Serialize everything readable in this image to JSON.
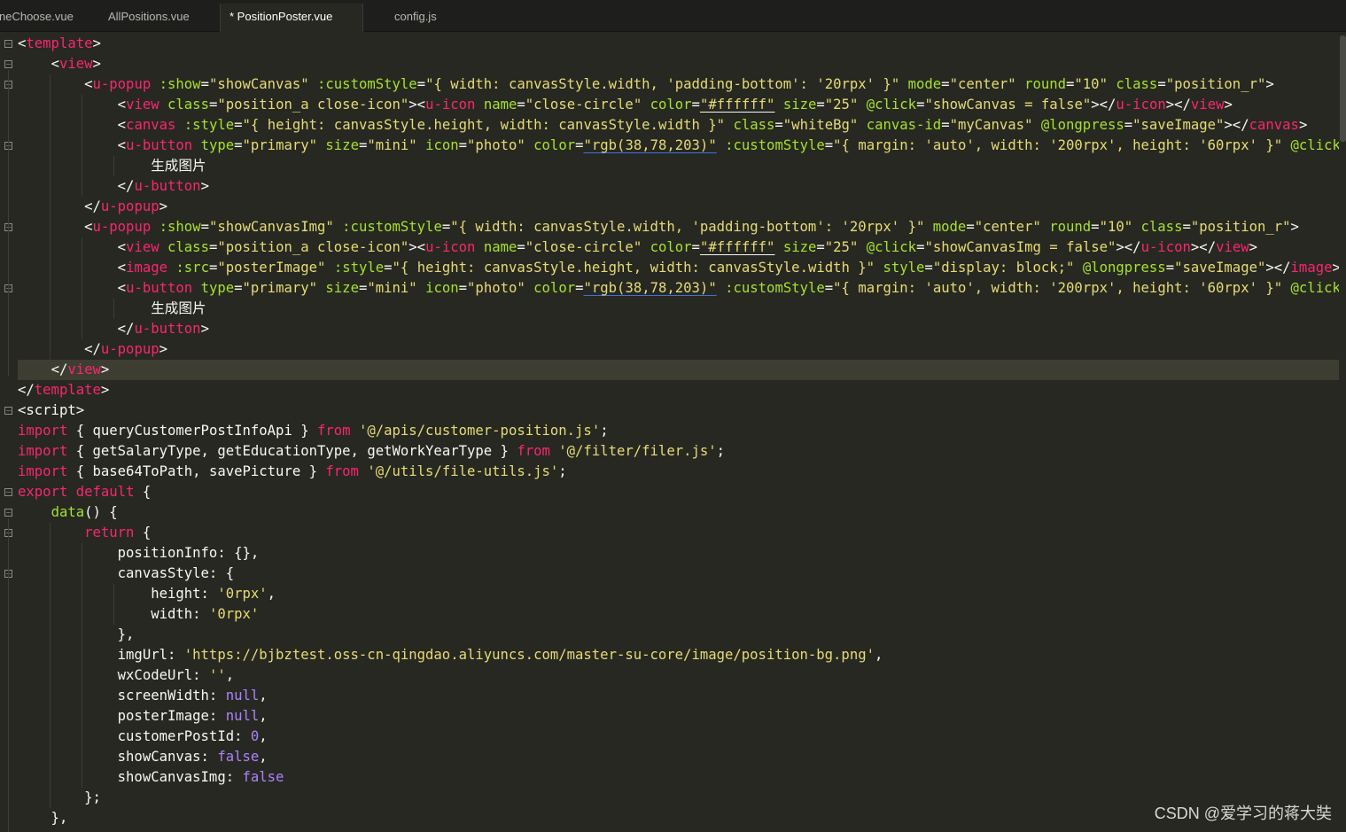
{
  "tabs": [
    {
      "label": "neChoose.vue",
      "active": false
    },
    {
      "label": "AllPositions.vue",
      "active": false
    },
    {
      "label": "* PositionPoster.vue",
      "active": true
    },
    {
      "label": "config.js",
      "active": false
    }
  ],
  "highlighted_line": 17,
  "folded_lines": [
    1,
    2,
    3,
    6,
    10,
    13,
    19,
    23,
    24,
    25,
    27
  ],
  "code_lines": [
    [
      [
        "t-punc",
        "<"
      ],
      [
        "t-tag",
        "template"
      ],
      [
        "t-punc",
        ">"
      ]
    ],
    [
      [
        "t-txt",
        "    "
      ],
      [
        "t-punc",
        "<"
      ],
      [
        "t-tag",
        "view"
      ],
      [
        "t-punc",
        ">"
      ]
    ],
    [
      [
        "t-txt",
        "        "
      ],
      [
        "t-punc",
        "<"
      ],
      [
        "t-tag",
        "u-popup"
      ],
      [
        "t-txt",
        " "
      ],
      [
        "t-attr",
        ":show"
      ],
      [
        "t-punc",
        "="
      ],
      [
        "t-str",
        "\"showCanvas\""
      ],
      [
        "t-txt",
        " "
      ],
      [
        "t-attr",
        ":customStyle"
      ],
      [
        "t-punc",
        "="
      ],
      [
        "t-str",
        "\"{ width: canvasStyle.width, 'padding-bottom': '20rpx' }\""
      ],
      [
        "t-txt",
        " "
      ],
      [
        "t-attr",
        "mode"
      ],
      [
        "t-punc",
        "="
      ],
      [
        "t-str",
        "\"center\""
      ],
      [
        "t-txt",
        " "
      ],
      [
        "t-attr",
        "round"
      ],
      [
        "t-punc",
        "="
      ],
      [
        "t-str",
        "\"10\""
      ],
      [
        "t-txt",
        " "
      ],
      [
        "t-attr",
        "class"
      ],
      [
        "t-punc",
        "="
      ],
      [
        "t-str",
        "\"position_r\""
      ],
      [
        "t-punc",
        ">"
      ]
    ],
    [
      [
        "t-txt",
        "            "
      ],
      [
        "t-punc",
        "<"
      ],
      [
        "t-tag",
        "view"
      ],
      [
        "t-txt",
        " "
      ],
      [
        "t-attr",
        "class"
      ],
      [
        "t-punc",
        "="
      ],
      [
        "t-str",
        "\"position_a close-icon\""
      ],
      [
        "t-punc",
        "><"
      ],
      [
        "t-tag",
        "u-icon"
      ],
      [
        "t-txt",
        " "
      ],
      [
        "t-attr",
        "name"
      ],
      [
        "t-punc",
        "="
      ],
      [
        "t-str",
        "\"close-circle\""
      ],
      [
        "t-txt",
        " "
      ],
      [
        "t-attr",
        "color"
      ],
      [
        "t-punc",
        "="
      ],
      [
        "t-str t-ulw",
        "\"#ffffff\""
      ],
      [
        "t-txt",
        " "
      ],
      [
        "t-attr",
        "size"
      ],
      [
        "t-punc",
        "="
      ],
      [
        "t-str",
        "\"25\""
      ],
      [
        "t-txt",
        " "
      ],
      [
        "t-attr",
        "@click"
      ],
      [
        "t-punc",
        "="
      ],
      [
        "t-str",
        "\"showCanvas = false\""
      ],
      [
        "t-punc",
        "></"
      ],
      [
        "t-tag",
        "u-icon"
      ],
      [
        "t-punc",
        "></"
      ],
      [
        "t-tag",
        "view"
      ],
      [
        "t-punc",
        ">"
      ]
    ],
    [
      [
        "t-txt",
        "            "
      ],
      [
        "t-punc",
        "<"
      ],
      [
        "t-tag",
        "canvas"
      ],
      [
        "t-txt",
        " "
      ],
      [
        "t-attr",
        ":style"
      ],
      [
        "t-punc",
        "="
      ],
      [
        "t-str",
        "\"{ height: canvasStyle.height, width: canvasStyle.width }\""
      ],
      [
        "t-txt",
        " "
      ],
      [
        "t-attr",
        "class"
      ],
      [
        "t-punc",
        "="
      ],
      [
        "t-str",
        "\"whiteBg\""
      ],
      [
        "t-txt",
        " "
      ],
      [
        "t-attr",
        "canvas-id"
      ],
      [
        "t-punc",
        "="
      ],
      [
        "t-str",
        "\"myCanvas\""
      ],
      [
        "t-txt",
        " "
      ],
      [
        "t-attr",
        "@longpress"
      ],
      [
        "t-punc",
        "="
      ],
      [
        "t-str",
        "\"saveImage\""
      ],
      [
        "t-punc",
        "></"
      ],
      [
        "t-tag",
        "canvas"
      ],
      [
        "t-punc",
        ">"
      ]
    ],
    [
      [
        "t-txt",
        "            "
      ],
      [
        "t-punc",
        "<"
      ],
      [
        "t-tag",
        "u-button"
      ],
      [
        "t-txt",
        " "
      ],
      [
        "t-attr",
        "type"
      ],
      [
        "t-punc",
        "="
      ],
      [
        "t-str",
        "\"primary\""
      ],
      [
        "t-txt",
        " "
      ],
      [
        "t-attr",
        "size"
      ],
      [
        "t-punc",
        "="
      ],
      [
        "t-str",
        "\"mini\""
      ],
      [
        "t-txt",
        " "
      ],
      [
        "t-attr",
        "icon"
      ],
      [
        "t-punc",
        "="
      ],
      [
        "t-str",
        "\"photo\""
      ],
      [
        "t-txt",
        " "
      ],
      [
        "t-attr",
        "color"
      ],
      [
        "t-punc",
        "="
      ],
      [
        "t-str t-ul",
        "\"rgb(38,78,203)\""
      ],
      [
        "t-txt",
        " "
      ],
      [
        "t-attr",
        ":customStyle"
      ],
      [
        "t-punc",
        "="
      ],
      [
        "t-str",
        "\"{ margin: 'auto', width: '200rpx', height: '60rpx' }\""
      ],
      [
        "t-txt",
        " "
      ],
      [
        "t-attr",
        "@click"
      ],
      [
        "t-punc",
        "="
      ],
      [
        "t-str",
        "\"saveI"
      ]
    ],
    [
      [
        "t-txt",
        "                生成图片"
      ]
    ],
    [
      [
        "t-txt",
        "            "
      ],
      [
        "t-punc",
        "</"
      ],
      [
        "t-tag",
        "u-button"
      ],
      [
        "t-punc",
        ">"
      ]
    ],
    [
      [
        "t-txt",
        "        "
      ],
      [
        "t-punc",
        "</"
      ],
      [
        "t-tag",
        "u-popup"
      ],
      [
        "t-punc",
        ">"
      ]
    ],
    [
      [
        "t-txt",
        "        "
      ],
      [
        "t-punc",
        "<"
      ],
      [
        "t-tag",
        "u-popup"
      ],
      [
        "t-txt",
        " "
      ],
      [
        "t-attr",
        ":show"
      ],
      [
        "t-punc",
        "="
      ],
      [
        "t-str",
        "\"showCanvasImg\""
      ],
      [
        "t-txt",
        " "
      ],
      [
        "t-attr",
        ":customStyle"
      ],
      [
        "t-punc",
        "="
      ],
      [
        "t-str",
        "\"{ width: canvasStyle.width, 'padding-bottom': '20rpx' }\""
      ],
      [
        "t-txt",
        " "
      ],
      [
        "t-attr",
        "mode"
      ],
      [
        "t-punc",
        "="
      ],
      [
        "t-str",
        "\"center\""
      ],
      [
        "t-txt",
        " "
      ],
      [
        "t-attr",
        "round"
      ],
      [
        "t-punc",
        "="
      ],
      [
        "t-str",
        "\"10\""
      ],
      [
        "t-txt",
        " "
      ],
      [
        "t-attr",
        "class"
      ],
      [
        "t-punc",
        "="
      ],
      [
        "t-str",
        "\"position_r\""
      ],
      [
        "t-punc",
        ">"
      ]
    ],
    [
      [
        "t-txt",
        "            "
      ],
      [
        "t-punc",
        "<"
      ],
      [
        "t-tag",
        "view"
      ],
      [
        "t-txt",
        " "
      ],
      [
        "t-attr",
        "class"
      ],
      [
        "t-punc",
        "="
      ],
      [
        "t-str",
        "\"position_a close-icon\""
      ],
      [
        "t-punc",
        "><"
      ],
      [
        "t-tag",
        "u-icon"
      ],
      [
        "t-txt",
        " "
      ],
      [
        "t-attr",
        "name"
      ],
      [
        "t-punc",
        "="
      ],
      [
        "t-str",
        "\"close-circle\""
      ],
      [
        "t-txt",
        " "
      ],
      [
        "t-attr",
        "color"
      ],
      [
        "t-punc",
        "="
      ],
      [
        "t-str t-ulw",
        "\"#ffffff\""
      ],
      [
        "t-txt",
        " "
      ],
      [
        "t-attr",
        "size"
      ],
      [
        "t-punc",
        "="
      ],
      [
        "t-str",
        "\"25\""
      ],
      [
        "t-txt",
        " "
      ],
      [
        "t-attr",
        "@click"
      ],
      [
        "t-punc",
        "="
      ],
      [
        "t-str",
        "\"showCanvasImg = false\""
      ],
      [
        "t-punc",
        "></"
      ],
      [
        "t-tag",
        "u-icon"
      ],
      [
        "t-punc",
        "></"
      ],
      [
        "t-tag",
        "view"
      ],
      [
        "t-punc",
        ">"
      ]
    ],
    [
      [
        "t-txt",
        "            "
      ],
      [
        "t-punc",
        "<"
      ],
      [
        "t-tag",
        "image"
      ],
      [
        "t-txt",
        " "
      ],
      [
        "t-attr",
        ":src"
      ],
      [
        "t-punc",
        "="
      ],
      [
        "t-str",
        "\"posterImage\""
      ],
      [
        "t-txt",
        " "
      ],
      [
        "t-attr",
        ":style"
      ],
      [
        "t-punc",
        "="
      ],
      [
        "t-str",
        "\"{ height: canvasStyle.height, width: canvasStyle.width }\""
      ],
      [
        "t-txt",
        " "
      ],
      [
        "t-attr",
        "style"
      ],
      [
        "t-punc",
        "="
      ],
      [
        "t-str",
        "\"display: block;\""
      ],
      [
        "t-txt",
        " "
      ],
      [
        "t-attr",
        "@longpress"
      ],
      [
        "t-punc",
        "="
      ],
      [
        "t-str",
        "\"saveImage\""
      ],
      [
        "t-punc",
        "></"
      ],
      [
        "t-tag",
        "image"
      ],
      [
        "t-punc",
        ">"
      ]
    ],
    [
      [
        "t-txt",
        "            "
      ],
      [
        "t-punc",
        "<"
      ],
      [
        "t-tag",
        "u-button"
      ],
      [
        "t-txt",
        " "
      ],
      [
        "t-attr",
        "type"
      ],
      [
        "t-punc",
        "="
      ],
      [
        "t-str",
        "\"primary\""
      ],
      [
        "t-txt",
        " "
      ],
      [
        "t-attr",
        "size"
      ],
      [
        "t-punc",
        "="
      ],
      [
        "t-str",
        "\"mini\""
      ],
      [
        "t-txt",
        " "
      ],
      [
        "t-attr",
        "icon"
      ],
      [
        "t-punc",
        "="
      ],
      [
        "t-str",
        "\"photo\""
      ],
      [
        "t-txt",
        " "
      ],
      [
        "t-attr",
        "color"
      ],
      [
        "t-punc",
        "="
      ],
      [
        "t-str t-ul",
        "\"rgb(38,78,203)\""
      ],
      [
        "t-txt",
        " "
      ],
      [
        "t-attr",
        ":customStyle"
      ],
      [
        "t-punc",
        "="
      ],
      [
        "t-str",
        "\"{ margin: 'auto', width: '200rpx', height: '60rpx' }\""
      ],
      [
        "t-txt",
        " "
      ],
      [
        "t-attr",
        "@click"
      ],
      [
        "t-punc",
        "="
      ],
      [
        "t-str",
        "\"saveI"
      ]
    ],
    [
      [
        "t-txt",
        "                生成图片"
      ]
    ],
    [
      [
        "t-txt",
        "            "
      ],
      [
        "t-punc",
        "</"
      ],
      [
        "t-tag",
        "u-button"
      ],
      [
        "t-punc",
        ">"
      ]
    ],
    [
      [
        "t-txt",
        "        "
      ],
      [
        "t-punc",
        "</"
      ],
      [
        "t-tag",
        "u-popup"
      ],
      [
        "t-punc",
        ">"
      ]
    ],
    [
      [
        "t-txt",
        "    "
      ],
      [
        "t-punc",
        "</"
      ],
      [
        "t-tag",
        "view"
      ],
      [
        "t-punc",
        ">"
      ]
    ],
    [
      [
        "t-punc",
        "</"
      ],
      [
        "t-tag",
        "template"
      ],
      [
        "t-punc",
        ">"
      ]
    ],
    [
      [
        "t-punc",
        "<"
      ],
      [
        "t-txt",
        "script"
      ],
      [
        "t-punc",
        ">"
      ]
    ],
    [
      [
        "t-kw",
        "import"
      ],
      [
        "t-txt",
        " { queryCustomerPostInfoApi } "
      ],
      [
        "t-kw",
        "from"
      ],
      [
        "t-txt",
        " "
      ],
      [
        "t-str",
        "'@/apis/customer-position.js'"
      ],
      [
        "t-txt",
        ";"
      ]
    ],
    [
      [
        "t-kw",
        "import"
      ],
      [
        "t-txt",
        " { getSalaryType, getEducationType, getWorkYearType } "
      ],
      [
        "t-kw",
        "from"
      ],
      [
        "t-txt",
        " "
      ],
      [
        "t-str",
        "'@/filter/filer.js'"
      ],
      [
        "t-txt",
        ";"
      ]
    ],
    [
      [
        "t-kw",
        "import"
      ],
      [
        "t-txt",
        " { base64ToPath, savePicture } "
      ],
      [
        "t-kw",
        "from"
      ],
      [
        "t-txt",
        " "
      ],
      [
        "t-str",
        "'@/utils/file-utils.js'"
      ],
      [
        "t-txt",
        ";"
      ]
    ],
    [
      [
        "t-kw",
        "export"
      ],
      [
        "t-txt",
        " "
      ],
      [
        "t-kw",
        "default"
      ],
      [
        "t-txt",
        " {"
      ]
    ],
    [
      [
        "t-txt",
        "    "
      ],
      [
        "t-func",
        "data"
      ],
      [
        "t-txt",
        "() {"
      ]
    ],
    [
      [
        "t-txt",
        "        "
      ],
      [
        "t-kw",
        "return"
      ],
      [
        "t-txt",
        " {"
      ]
    ],
    [
      [
        "t-txt",
        "            positionInfo: {},"
      ]
    ],
    [
      [
        "t-txt",
        "            canvasStyle: {"
      ]
    ],
    [
      [
        "t-txt",
        "                height: "
      ],
      [
        "t-str",
        "'0rpx'"
      ],
      [
        "t-txt",
        ","
      ]
    ],
    [
      [
        "t-txt",
        "                width: "
      ],
      [
        "t-str",
        "'0rpx'"
      ]
    ],
    [
      [
        "t-txt",
        "            },"
      ]
    ],
    [
      [
        "t-txt",
        "            imgUrl: "
      ],
      [
        "t-str",
        "'https://bjbztest.oss-cn-qingdao.aliyuncs.com/master-su-core/image/position-bg.png'"
      ],
      [
        "t-txt",
        ","
      ]
    ],
    [
      [
        "t-txt",
        "            wxCodeUrl: "
      ],
      [
        "t-str",
        "''"
      ],
      [
        "t-txt",
        ","
      ]
    ],
    [
      [
        "t-txt",
        "            screenWidth: "
      ],
      [
        "t-num",
        "null"
      ],
      [
        "t-txt",
        ","
      ]
    ],
    [
      [
        "t-txt",
        "            posterImage: "
      ],
      [
        "t-num",
        "null"
      ],
      [
        "t-txt",
        ","
      ]
    ],
    [
      [
        "t-txt",
        "            customerPostId: "
      ],
      [
        "t-num",
        "0"
      ],
      [
        "t-txt",
        ","
      ]
    ],
    [
      [
        "t-txt",
        "            showCanvas: "
      ],
      [
        "t-num",
        "false"
      ],
      [
        "t-txt",
        ","
      ]
    ],
    [
      [
        "t-txt",
        "            showCanvasImg: "
      ],
      [
        "t-num",
        "false"
      ]
    ],
    [
      [
        "t-txt",
        "        };"
      ]
    ],
    [
      [
        "t-txt",
        "    },"
      ]
    ]
  ],
  "watermark": "CSDN @爱学习的蒋大奘",
  "colors": {
    "background": "#272822",
    "tag": "#f92672",
    "attribute": "#a6e22e",
    "string": "#e6db74",
    "constant": "#ae81ff",
    "text": "#f8f8f2"
  }
}
